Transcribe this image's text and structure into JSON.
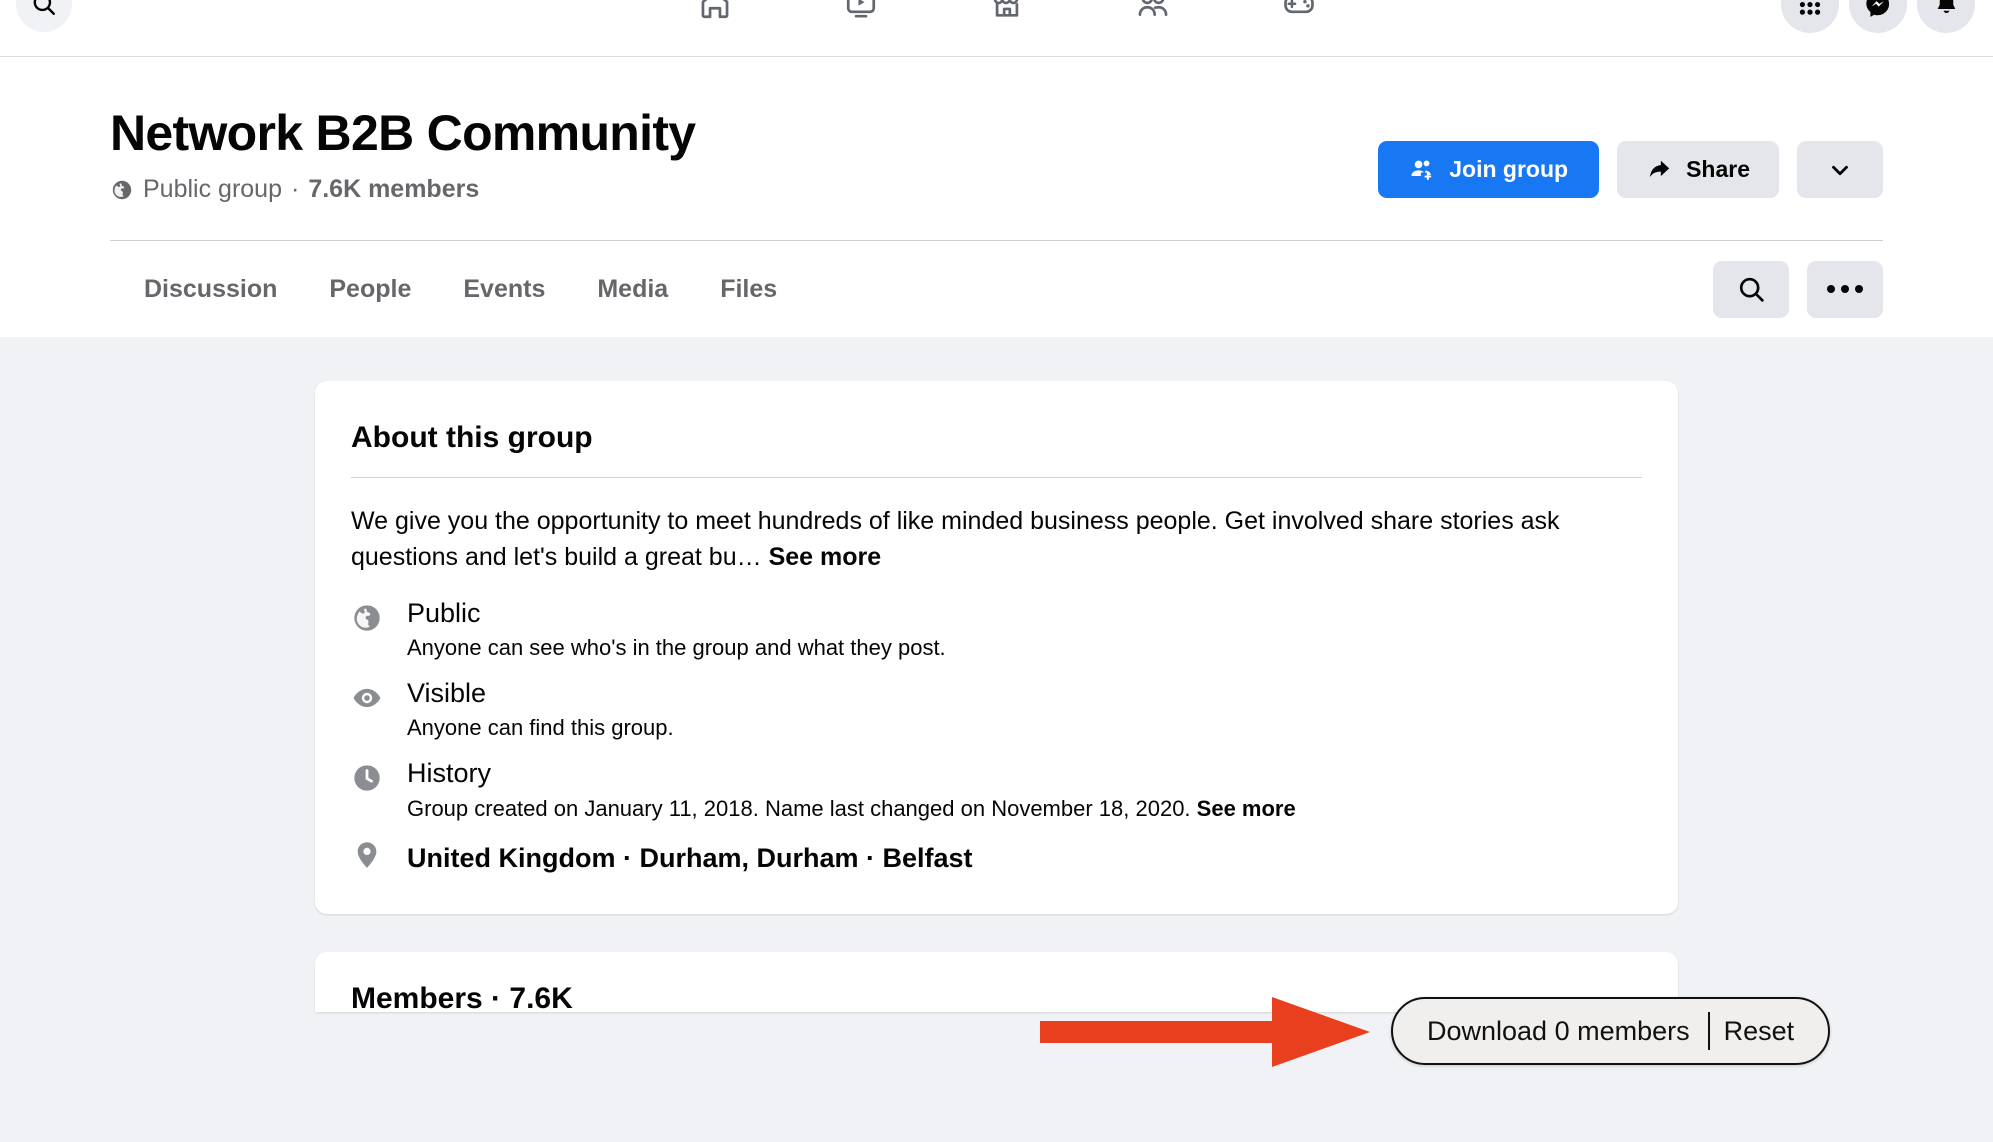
{
  "topnav": {
    "search_icon": "search-icon",
    "tabs": [
      {
        "name": "home",
        "icon": "home-icon"
      },
      {
        "name": "watch",
        "icon": "video-play-icon"
      },
      {
        "name": "marketplace",
        "icon": "storefront-icon"
      },
      {
        "name": "groups",
        "icon": "groups-icon"
      },
      {
        "name": "gaming",
        "icon": "game-controller-icon"
      }
    ],
    "right_buttons": [
      {
        "name": "menu",
        "icon": "grid-menu-icon"
      },
      {
        "name": "messenger",
        "icon": "messenger-icon"
      },
      {
        "name": "notifications",
        "icon": "bell-icon"
      }
    ]
  },
  "group": {
    "title": "Network B2B Community",
    "privacy": "Public group",
    "separator": "·",
    "members": "7.6K members",
    "privacy_icon": "globe-icon"
  },
  "actions": {
    "join_label": "Join group",
    "join_icon": "add-people-icon",
    "share_label": "Share",
    "share_icon": "share-arrow-icon",
    "more_icon": "chevron-down-icon"
  },
  "tabs": [
    {
      "label": "Discussion"
    },
    {
      "label": "People"
    },
    {
      "label": "Events"
    },
    {
      "label": "Media"
    },
    {
      "label": "Files"
    }
  ],
  "tab_tools": {
    "search_icon": "search-icon",
    "more_icon": "ellipsis-icon"
  },
  "about": {
    "heading": "About this group",
    "description": "We give you the opportunity to meet hundreds of like minded business people. Get involved share stories ask questions and let's build a great bu…",
    "see_more": "See more",
    "rows": [
      {
        "icon": "globe-icon",
        "label": "Public",
        "sub": "Anyone can see who's in the group and what they post."
      },
      {
        "icon": "eye-icon",
        "label": "Visible",
        "sub": "Anyone can find this group."
      },
      {
        "icon": "clock-icon",
        "label": "History",
        "sub": "Group created on January 11, 2018. Name last changed on November 18, 2020.",
        "sub_link": "See more"
      }
    ],
    "location": {
      "icon": "location-pin-icon",
      "text": "United Kingdom · Durham, Durham · Belfast"
    }
  },
  "members_card": {
    "title": "Members · 7.6K"
  },
  "download_widget": {
    "download_label": "Download 0 members",
    "reset_label": "Reset",
    "arrow_color": "#e8401f",
    "border_color": "#111111",
    "background": "#f0efed"
  },
  "colors": {
    "accent_blue": "#1877f2",
    "page_background": "#f0f2f5",
    "card_background": "#ffffff",
    "secondary_button": "#e4e6eb",
    "muted_text": "#65676b",
    "arrow_red": "#e8401f"
  }
}
